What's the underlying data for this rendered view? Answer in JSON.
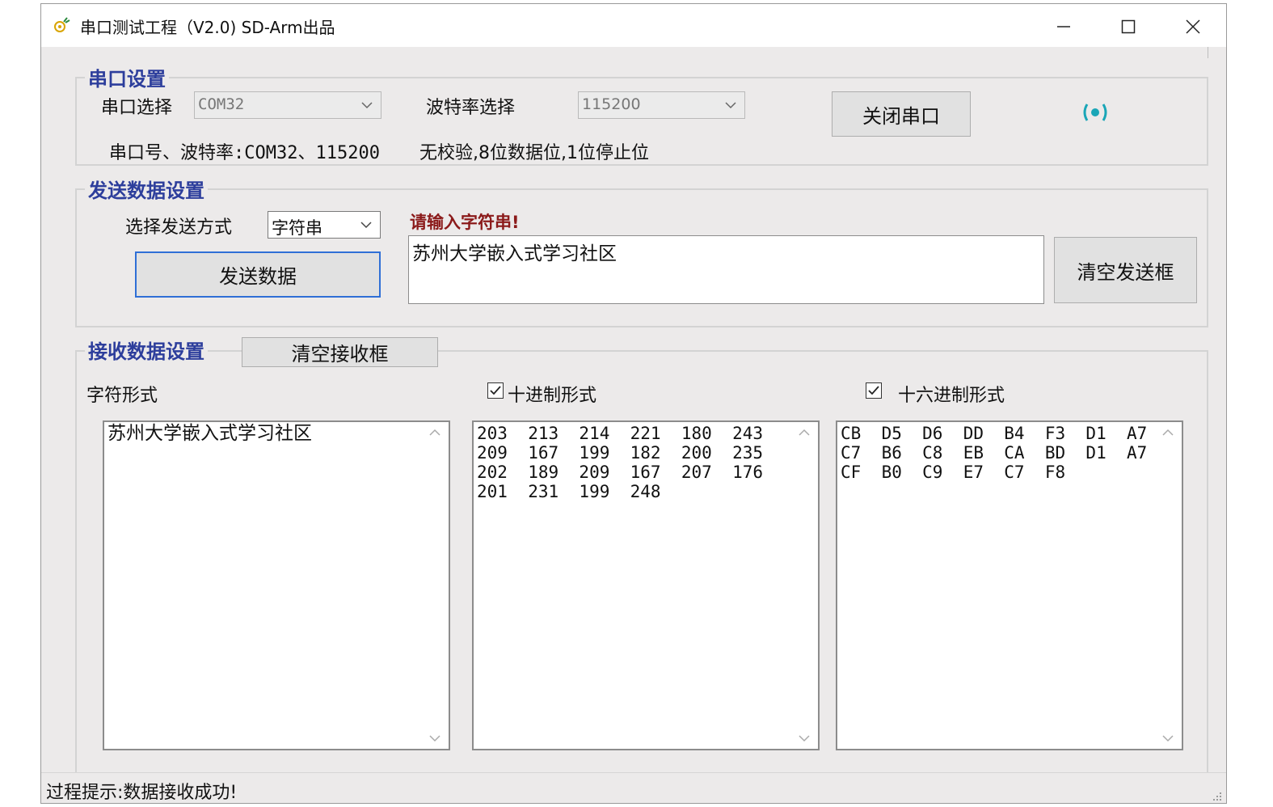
{
  "window": {
    "title": "串口测试工程（V2.0)    SD-Arm出品",
    "minimize_icon": "minimize-icon",
    "maximize_icon": "maximize-icon",
    "close_icon": "close-icon"
  },
  "serial_settings": {
    "legend": "串口设置",
    "port_label": "串口选择",
    "port_value": "COM32",
    "baud_label": "波特率选择",
    "baud_value": "115200",
    "close_button": "关闭串口",
    "status_icon": "signal-icon",
    "status_icon_color": "#1aa6b7",
    "info_text": "串口号、波特率:COM32、115200",
    "parity_text": "无校验,8位数据位,1位停止位"
  },
  "send_settings": {
    "legend": "发送数据设置",
    "mode_label": "选择发送方式",
    "mode_value": "字符串",
    "send_button": "发送数据",
    "prompt": "请输入字符串!",
    "prompt_color": "#8b1a1a",
    "input_value": "苏州大学嵌入式学习社区",
    "clear_button": "清空发送框"
  },
  "receive_settings": {
    "legend": "接收数据设置",
    "clear_button": "清空接收框",
    "char_label": "字符形式",
    "decimal_label": "十进制形式",
    "decimal_checked": true,
    "hex_label": "十六进制形式",
    "hex_checked": true,
    "char_content": "苏州大学嵌入式学习社区",
    "decimal_content": "203  213  214  221  180  243\n209  167  199  182  200  235\n202  189  209  167  207  176\n201  231  199  248",
    "hex_content": "CB  D5  D6  DD  B4  F3  D1  A7\nC7  B6  C8  EB  CA  BD  D1  A7\nCF  B0  C9  E7  C7  F8"
  },
  "status": {
    "text": "过程提示:数据接收成功!"
  }
}
